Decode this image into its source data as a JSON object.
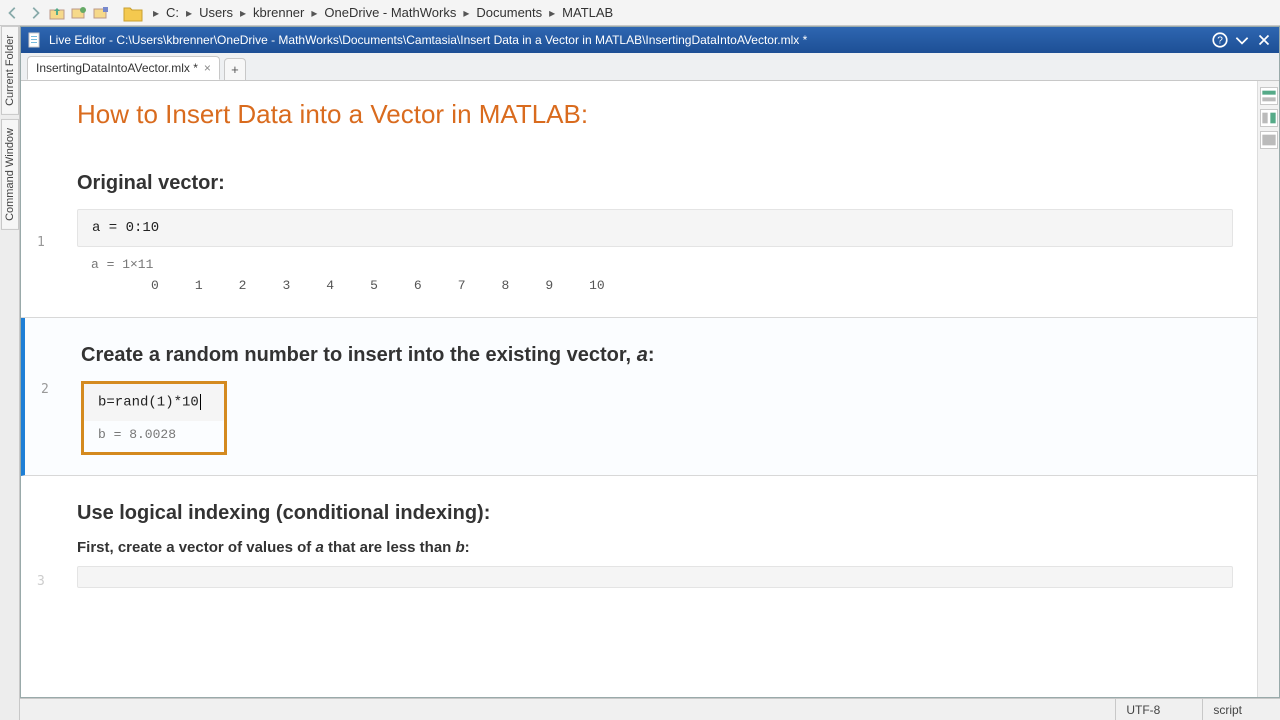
{
  "breadcrumbs": [
    "C:",
    "Users",
    "kbrenner",
    "OneDrive - MathWorks",
    "Documents",
    "MATLAB"
  ],
  "sideTabs": {
    "a": "Current Folder",
    "b": "Command Window"
  },
  "window": {
    "title": "Live Editor - C:\\Users\\kbrenner\\OneDrive - MathWorks\\Documents\\Camtasia\\Insert Data in a Vector in MATLAB\\InsertingDataIntoAVector.mlx *"
  },
  "tab": {
    "label": "InsertingDataIntoAVector.mlx *"
  },
  "doc": {
    "title": "How to Insert Data into a Vector in MATLAB:",
    "sec1": {
      "heading": "Original vector:",
      "code": "a = 0:10",
      "outhead": "a = 1×11",
      "vals": [
        "0",
        "1",
        "2",
        "3",
        "4",
        "5",
        "6",
        "7",
        "8",
        "9",
        "10"
      ]
    },
    "sec2": {
      "heading_pre": "Create a random number to insert into the existing vector, ",
      "heading_it": "a",
      "heading_post": ":",
      "code": "b=rand(1)*10",
      "out": "b = 8.0028"
    },
    "sec3": {
      "heading": "Use logical indexing (conditional indexing):",
      "desc_pre": "First, create a vector of values of ",
      "desc_a": "a",
      "desc_mid": " that are less than ",
      "desc_b": "b",
      "desc_post": ":"
    }
  },
  "lines": {
    "l1": "1",
    "l2": "2",
    "l3": "3"
  },
  "status": {
    "enc": "UTF-8",
    "mode": "script"
  }
}
